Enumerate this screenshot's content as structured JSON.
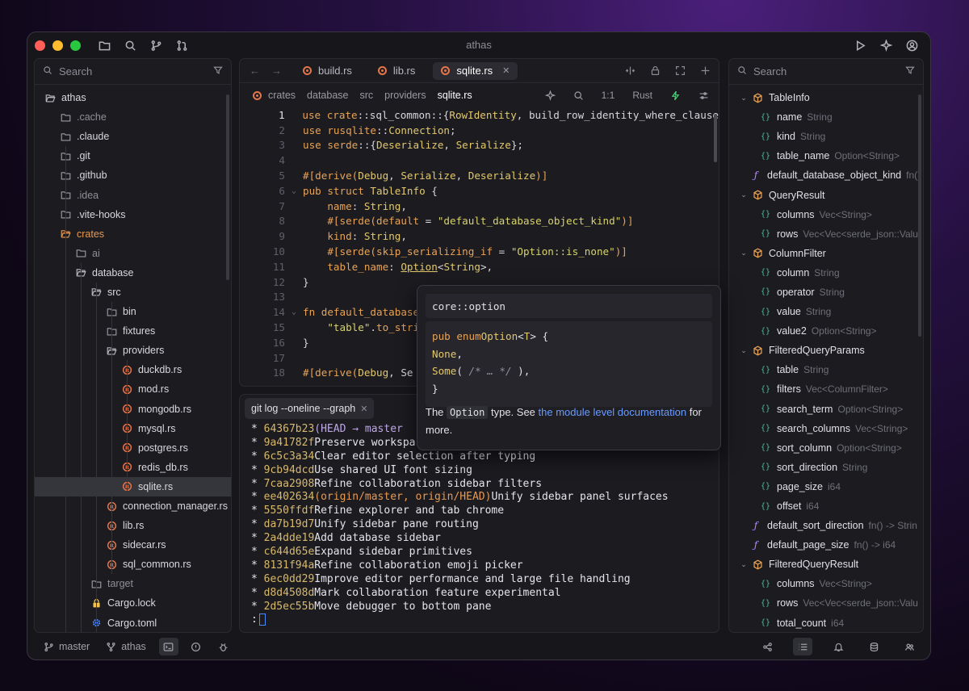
{
  "window": {
    "title": "athas"
  },
  "colors": {
    "accent": "#4a8bff",
    "folder_orange": "#e69a54",
    "rust": "#e5764b"
  },
  "left_panel": {
    "search_placeholder": "Search",
    "tree": [
      {
        "label": "athas",
        "icon": "folder-open-icon",
        "depth": 0,
        "style": "normal"
      },
      {
        "label": ".cache",
        "icon": "folder-icon",
        "depth": 1,
        "style": "dim"
      },
      {
        "label": ".claude",
        "icon": "folder-icon",
        "depth": 1,
        "style": "normal"
      },
      {
        "label": ".git",
        "icon": "folder-icon",
        "depth": 1,
        "style": "normal"
      },
      {
        "label": ".github",
        "icon": "folder-icon",
        "depth": 1,
        "style": "normal"
      },
      {
        "label": ".idea",
        "icon": "folder-icon",
        "depth": 1,
        "style": "dim"
      },
      {
        "label": ".vite-hooks",
        "icon": "folder-icon",
        "depth": 1,
        "style": "normal"
      },
      {
        "label": "crates",
        "icon": "folder-open-icon",
        "depth": 1,
        "style": "orange"
      },
      {
        "label": "ai",
        "icon": "folder-icon",
        "depth": 2,
        "style": "dim"
      },
      {
        "label": "database",
        "icon": "folder-open-icon",
        "depth": 2,
        "style": "normal"
      },
      {
        "label": "src",
        "icon": "folder-open-icon",
        "depth": 3,
        "style": "normal"
      },
      {
        "label": "bin",
        "icon": "folder-icon",
        "depth": 4,
        "style": "normal"
      },
      {
        "label": "fixtures",
        "icon": "folder-icon",
        "depth": 4,
        "style": "normal"
      },
      {
        "label": "providers",
        "icon": "folder-open-icon",
        "depth": 4,
        "style": "normal"
      },
      {
        "label": "duckdb.rs",
        "icon": "rust-file-icon",
        "depth": 5,
        "style": "normal"
      },
      {
        "label": "mod.rs",
        "icon": "rust-file-icon",
        "depth": 5,
        "style": "normal"
      },
      {
        "label": "mongodb.rs",
        "icon": "rust-file-icon",
        "depth": 5,
        "style": "normal"
      },
      {
        "label": "mysql.rs",
        "icon": "rust-file-icon",
        "depth": 5,
        "style": "normal"
      },
      {
        "label": "postgres.rs",
        "icon": "rust-file-icon",
        "depth": 5,
        "style": "normal"
      },
      {
        "label": "redis_db.rs",
        "icon": "rust-file-icon",
        "depth": 5,
        "style": "normal"
      },
      {
        "label": "sqlite.rs",
        "icon": "rust-file-icon",
        "depth": 5,
        "style": "selected"
      },
      {
        "label": "connection_manager.rs",
        "icon": "rust-file-icon",
        "depth": 4,
        "style": "normal"
      },
      {
        "label": "lib.rs",
        "icon": "rust-file-icon",
        "depth": 4,
        "style": "normal"
      },
      {
        "label": "sidecar.rs",
        "icon": "rust-file-icon",
        "depth": 4,
        "style": "normal"
      },
      {
        "label": "sql_common.rs",
        "icon": "rust-file-icon",
        "depth": 4,
        "style": "normal"
      },
      {
        "label": "target",
        "icon": "folder-icon",
        "depth": 3,
        "style": "dim"
      },
      {
        "label": "Cargo.lock",
        "icon": "lock-icon",
        "depth": 3,
        "style": "normal"
      },
      {
        "label": "Cargo.toml",
        "icon": "gear-icon",
        "depth": 3,
        "style": "normal"
      }
    ]
  },
  "editor": {
    "tabs": [
      {
        "label": "build.rs",
        "active": false
      },
      {
        "label": "lib.rs",
        "active": false
      },
      {
        "label": "sqlite.rs",
        "active": true
      }
    ],
    "breadcrumb": [
      "crates",
      "database",
      "src",
      "providers",
      "sqlite.rs"
    ],
    "position": "1:1",
    "language": "Rust",
    "lines": [
      {
        "n": "1",
        "fold": "",
        "html": "<span class='kw'>use</span> <span class='kw'>crate</span>::sql_common::{<span class='ty'>RowIdentity</span>, build_row_identity_where_clause"
      },
      {
        "n": "2",
        "fold": "",
        "html": "<span class='kw'>use</span> <span class='kw'>rusqlite</span>::<span class='ty'>Connection</span>;"
      },
      {
        "n": "3",
        "fold": "",
        "html": "<span class='kw'>use</span> <span class='kw'>serde</span>::{<span class='ty'>Deserialize</span>, <span class='ty'>Serialize</span>};"
      },
      {
        "n": "4",
        "fold": "",
        "html": ""
      },
      {
        "n": "5",
        "fold": "",
        "html": "<span class='kw'>#[derive(</span><span class='ty'>Debug</span>, <span class='ty'>Serialize</span>, <span class='ty'>Deserialize</span><span class='kw'>)]</span>"
      },
      {
        "n": "6",
        "fold": "⌄",
        "html": "<span class='kw'>pub struct</span> <span class='ty'>TableInfo</span> {"
      },
      {
        "n": "7",
        "fold": "",
        "html": "    <span class='kw'>name</span>: <span class='ty'>String</span>,"
      },
      {
        "n": "8",
        "fold": "",
        "html": "    <span class='kw'>#[serde(default</span> = <span class='str'>\"default_database_object_kind\"</span><span class='kw'>)]</span>"
      },
      {
        "n": "9",
        "fold": "",
        "html": "    <span class='kw'>kind</span>: <span class='ty'>String</span>,"
      },
      {
        "n": "10",
        "fold": "",
        "html": "    <span class='kw'>#[serde(skip_serializing_if</span> = <span class='str'>\"Option::is_none\"</span><span class='kw'>)]</span>"
      },
      {
        "n": "11",
        "fold": "",
        "html": "    <span class='kw'>table_name</span>: <span class='ty' style='text-decoration:underline'>Option</span><<span class='ty'>String</span>>,"
      },
      {
        "n": "12",
        "fold": "",
        "html": "}"
      },
      {
        "n": "13",
        "fold": "",
        "html": ""
      },
      {
        "n": "14",
        "fold": "⌄",
        "html": "<span class='kw'>fn</span> <span class='kw'>default_database</span>"
      },
      {
        "n": "15",
        "fold": "",
        "html": "    <span class='str'>\"table\"</span>.<span class='kw'>to_stri</span>"
      },
      {
        "n": "16",
        "fold": "",
        "html": "}"
      },
      {
        "n": "17",
        "fold": "",
        "html": ""
      },
      {
        "n": "18",
        "fold": "",
        "html": "<span class='kw'>#[derive(</span><span class='ty'>Debug</span>, Se"
      }
    ]
  },
  "terminal": {
    "tab_label": "git log --oneline --graph",
    "lines": [
      {
        "hash": "64367b23",
        "refs": "(HEAD → master",
        "refclass": "ref1",
        "msg": ""
      },
      {
        "hash": "9a41782f",
        "refs": "",
        "refclass": "",
        "msg": "Preserve workspa"
      },
      {
        "hash": "6c5c3a34",
        "refs": "",
        "refclass": "",
        "msg": "Clear editor selection after typing"
      },
      {
        "hash": "9cb94dcd",
        "refs": "",
        "refclass": "",
        "msg": "Use shared UI font sizing"
      },
      {
        "hash": "7caa2908",
        "refs": "",
        "refclass": "",
        "msg": "Refine collaboration sidebar filters"
      },
      {
        "hash": "ee402634",
        "refs": "(origin/master, origin/HEAD)",
        "refclass": "ref2",
        "msg": "Unify sidebar panel surfaces"
      },
      {
        "hash": "5550ffdf",
        "refs": "",
        "refclass": "",
        "msg": "Refine explorer and tab chrome"
      },
      {
        "hash": "da7b19d7",
        "refs": "",
        "refclass": "",
        "msg": "Unify sidebar pane routing"
      },
      {
        "hash": "2a4dde19",
        "refs": "",
        "refclass": "",
        "msg": "Add database sidebar"
      },
      {
        "hash": "c644d65e",
        "refs": "",
        "refclass": "",
        "msg": "Expand sidebar primitives"
      },
      {
        "hash": "8131f94a",
        "refs": "",
        "refclass": "",
        "msg": "Refine collaboration emoji picker"
      },
      {
        "hash": "6ec0dd29",
        "refs": "",
        "refclass": "",
        "msg": "Improve editor performance and large file handling"
      },
      {
        "hash": "d8d4508d",
        "refs": "",
        "refclass": "",
        "msg": "Mark collaboration feature experimental"
      },
      {
        "hash": "2d5ec55b",
        "refs": "",
        "refclass": "",
        "msg": "Move debugger to bottom pane"
      }
    ],
    "prompt": ":"
  },
  "popup": {
    "header": "core::option",
    "code_lines": [
      "<span class='kw'>pub enum</span> <span class='ty'>Option</span><<span class='ty'>T</span>> {",
      "    <span class='ty'>None</span>,",
      "    <span class='ty'>Some</span>( <span style='color:#8f8f98;font-style:italic'>/* … */</span> ),",
      "}"
    ],
    "text_before": "The ",
    "text_code": "Option",
    "text_mid": " type. See ",
    "text_link": "the module level documentation",
    "text_after": " for more."
  },
  "right_panel": {
    "search_placeholder": "Search",
    "outline": [
      {
        "kind": "struct",
        "name": "TableInfo",
        "type": "",
        "indent": 0,
        "chev": true
      },
      {
        "kind": "field",
        "name": "name",
        "type": "String",
        "indent": 1,
        "chev": false
      },
      {
        "kind": "field",
        "name": "kind",
        "type": "String",
        "indent": 1,
        "chev": false
      },
      {
        "kind": "field",
        "name": "table_name",
        "type": "Option<String>",
        "indent": 1,
        "chev": false
      },
      {
        "kind": "func",
        "name": "default_database_object_kind",
        "type": "fn()",
        "indent": 0,
        "chev": false
      },
      {
        "kind": "struct",
        "name": "QueryResult",
        "type": "",
        "indent": 0,
        "chev": true
      },
      {
        "kind": "field",
        "name": "columns",
        "type": "Vec<String>",
        "indent": 1,
        "chev": false
      },
      {
        "kind": "field",
        "name": "rows",
        "type": "Vec<Vec<serde_json::Valu",
        "indent": 1,
        "chev": false
      },
      {
        "kind": "struct",
        "name": "ColumnFilter",
        "type": "",
        "indent": 0,
        "chev": true
      },
      {
        "kind": "field",
        "name": "column",
        "type": "String",
        "indent": 1,
        "chev": false
      },
      {
        "kind": "field",
        "name": "operator",
        "type": "String",
        "indent": 1,
        "chev": false
      },
      {
        "kind": "field",
        "name": "value",
        "type": "String",
        "indent": 1,
        "chev": false
      },
      {
        "kind": "field",
        "name": "value2",
        "type": "Option<String>",
        "indent": 1,
        "chev": false
      },
      {
        "kind": "struct",
        "name": "FilteredQueryParams",
        "type": "",
        "indent": 0,
        "chev": true
      },
      {
        "kind": "field",
        "name": "table",
        "type": "String",
        "indent": 1,
        "chev": false
      },
      {
        "kind": "field",
        "name": "filters",
        "type": "Vec<ColumnFilter>",
        "indent": 1,
        "chev": false
      },
      {
        "kind": "field",
        "name": "search_term",
        "type": "Option<String>",
        "indent": 1,
        "chev": false
      },
      {
        "kind": "field",
        "name": "search_columns",
        "type": "Vec<String>",
        "indent": 1,
        "chev": false
      },
      {
        "kind": "field",
        "name": "sort_column",
        "type": "Option<String>",
        "indent": 1,
        "chev": false
      },
      {
        "kind": "field",
        "name": "sort_direction",
        "type": "String",
        "indent": 1,
        "chev": false
      },
      {
        "kind": "field",
        "name": "page_size",
        "type": "i64",
        "indent": 1,
        "chev": false
      },
      {
        "kind": "field",
        "name": "offset",
        "type": "i64",
        "indent": 1,
        "chev": false
      },
      {
        "kind": "func",
        "name": "default_sort_direction",
        "type": "fn() -> Strin",
        "indent": 0,
        "chev": false
      },
      {
        "kind": "func",
        "name": "default_page_size",
        "type": "fn() -> i64",
        "indent": 0,
        "chev": false
      },
      {
        "kind": "struct",
        "name": "FilteredQueryResult",
        "type": "",
        "indent": 0,
        "chev": true
      },
      {
        "kind": "field",
        "name": "columns",
        "type": "Vec<String>",
        "indent": 1,
        "chev": false
      },
      {
        "kind": "field",
        "name": "rows",
        "type": "Vec<Vec<serde_json::Valu",
        "indent": 1,
        "chev": false
      },
      {
        "kind": "field",
        "name": "total_count",
        "type": "i64",
        "indent": 1,
        "chev": false
      }
    ]
  },
  "statusbar": {
    "branch": "master",
    "project": "athas"
  }
}
